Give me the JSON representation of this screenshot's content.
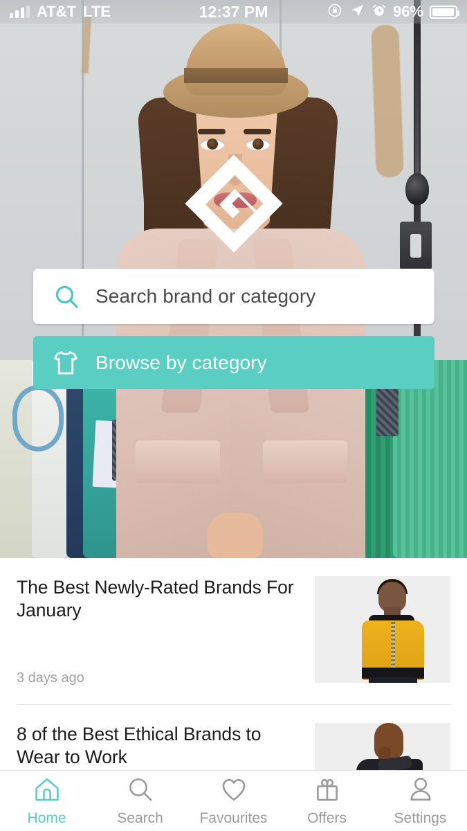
{
  "status_bar": {
    "signal_icon": "signal-bars-icon",
    "carrier": "AT&T",
    "radio": "LTE",
    "time": "12:37 PM",
    "rotation_lock_icon": "rotation-lock-icon",
    "location_icon": "location-arrow-icon",
    "alarm_icon": "alarm-clock-icon",
    "battery_percent": "96%",
    "battery_icon": "battery-icon",
    "battery_level": 96
  },
  "hero": {
    "logo_name": "app-logo-diamond",
    "image_description": "Woman in straw fedora and pink trench coat standing in front of clothing racks"
  },
  "search": {
    "icon": "search-icon",
    "placeholder": "Search brand or category",
    "value": ""
  },
  "browse": {
    "icon": "tshirt-icon",
    "label": "Browse by category"
  },
  "feed": {
    "articles": [
      {
        "title": "The Best Newly-Rated Brands For January",
        "time": "3 days ago",
        "thumb_name": "article-thumbnail-yellow-bomber-jacket"
      },
      {
        "title": "8 of the Best Ethical Brands to Wear to Work",
        "time": "",
        "thumb_name": "article-thumbnail-black-blazer"
      }
    ]
  },
  "tabbar": {
    "active_index": 0,
    "items": [
      {
        "label": "Home",
        "icon": "home-icon"
      },
      {
        "label": "Search",
        "icon": "search-icon"
      },
      {
        "label": "Favourites",
        "icon": "heart-icon"
      },
      {
        "label": "Offers",
        "icon": "gift-icon"
      },
      {
        "label": "Settings",
        "icon": "person-icon"
      }
    ]
  },
  "colors": {
    "accent": "#5bcec3",
    "inactive": "#9b9b9b",
    "text": "#1c1c1c",
    "muted": "#a2a2a2"
  }
}
